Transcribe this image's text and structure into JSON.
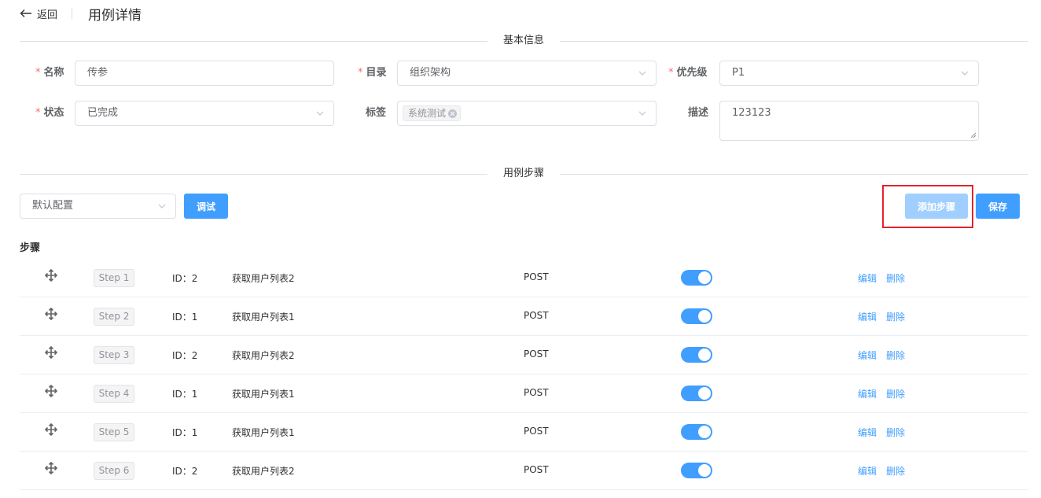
{
  "header": {
    "back_label": "返回",
    "title": "用例详情"
  },
  "sections": {
    "basic_info": "基本信息",
    "steps": "用例步骤"
  },
  "form": {
    "name": {
      "label": "名称",
      "value": "传参"
    },
    "directory": {
      "label": "目录",
      "value": "组织架构"
    },
    "priority": {
      "label": "优先级",
      "value": "P1"
    },
    "status": {
      "label": "状态",
      "value": "已完成"
    },
    "tags": {
      "label": "标签",
      "tag": "系统测试"
    },
    "description": {
      "label": "描述",
      "value": "123123"
    }
  },
  "toolbar": {
    "config_select": "默认配置",
    "debug_label": "调试",
    "add_step_label": "添加步骤",
    "save_label": "保存"
  },
  "steps_label": "步骤",
  "steps": [
    {
      "badge": "Step 1",
      "id": "ID：2",
      "name": "获取用户列表2",
      "method": "POST",
      "enabled": true
    },
    {
      "badge": "Step 2",
      "id": "ID：1",
      "name": "获取用户列表1",
      "method": "POST",
      "enabled": true
    },
    {
      "badge": "Step 3",
      "id": "ID：2",
      "name": "获取用户列表2",
      "method": "POST",
      "enabled": true
    },
    {
      "badge": "Step 4",
      "id": "ID：1",
      "name": "获取用户列表1",
      "method": "POST",
      "enabled": true
    },
    {
      "badge": "Step 5",
      "id": "ID：1",
      "name": "获取用户列表1",
      "method": "POST",
      "enabled": true
    },
    {
      "badge": "Step 6",
      "id": "ID：2",
      "name": "获取用户列表2",
      "method": "POST",
      "enabled": true
    }
  ],
  "row_actions": {
    "edit": "编辑",
    "delete": "删除"
  },
  "colors": {
    "primary": "#409eff",
    "primary_disabled": "#a0cfff",
    "required": "#f56c6c",
    "highlight": "#e5232a"
  }
}
